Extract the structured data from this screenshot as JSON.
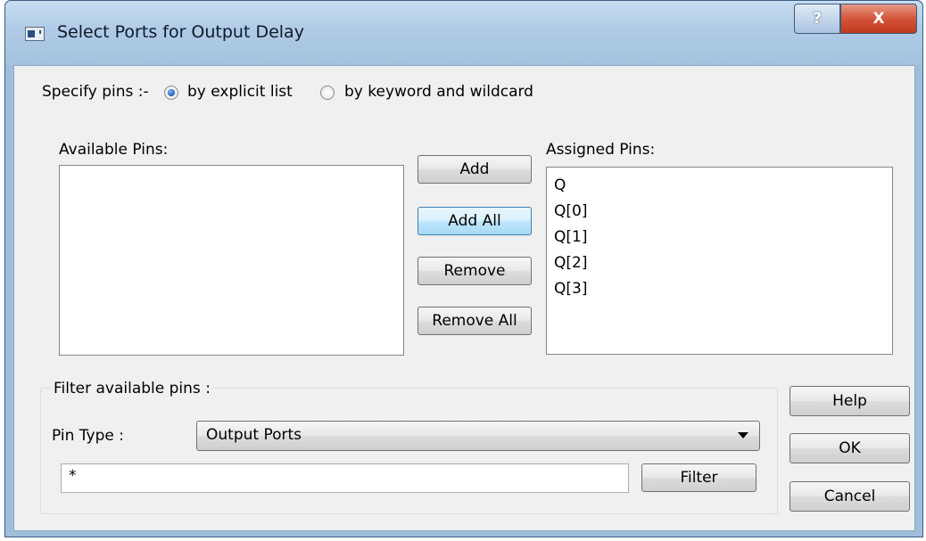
{
  "window": {
    "title": "Select Ports for Output Delay",
    "help_symbol": "?",
    "close_symbol": "X"
  },
  "specify": {
    "label": "Specify pins :-",
    "options": [
      {
        "label": "by explicit list",
        "selected": true
      },
      {
        "label": "by keyword and wildcard",
        "selected": false
      }
    ]
  },
  "available": {
    "label": "Available Pins:",
    "items": []
  },
  "assigned": {
    "label": "Assigned Pins:",
    "items": [
      "Q",
      "Q[0]",
      "Q[1]",
      "Q[2]",
      "Q[3]"
    ]
  },
  "transfer_buttons": {
    "add": "Add",
    "add_all": "Add All",
    "remove": "Remove",
    "remove_all": "Remove All"
  },
  "filter": {
    "group_label": "Filter available pins :",
    "pin_type_label": "Pin Type :",
    "pin_type_value": "Output Ports",
    "pattern_value": "*",
    "filter_button": "Filter"
  },
  "dialog_buttons": {
    "help": "Help",
    "ok": "OK",
    "cancel": "Cancel"
  },
  "colors": {
    "titlebar": "#afcbe6",
    "close_button": "#d4553a",
    "dialog_background": "#f0f0f0"
  }
}
